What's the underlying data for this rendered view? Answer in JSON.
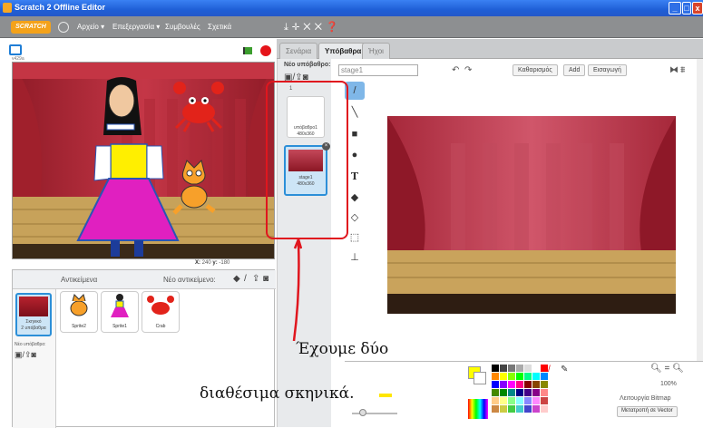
{
  "window": {
    "title": "Scratch 2 Offline Editor",
    "min": "_",
    "max": "□",
    "close": "x"
  },
  "menu": {
    "logo": "SCRATCH",
    "items": [
      "Αρχείο ▾",
      "Επεξεργασία ▾",
      "Συμβουλές",
      "Σχετικά"
    ],
    "tools_glyphs": "⤓✛✕✕❓"
  },
  "stage": {
    "version": "v429a",
    "coord_x_label": "X:",
    "coord_x": "240",
    "coord_y_label": "y:",
    "coord_y": "-180"
  },
  "sprites_pane": {
    "title": "Αντικείμενα",
    "new_sprite": "Νέο αντικείμενο:",
    "stage_thumb": {
      "label": "Σκηνικό",
      "sublabel": "2 υπόβαθρα"
    },
    "new_backdrop": "Νέο υπόβαθρο:",
    "sprites": [
      {
        "name": "Sprite2"
      },
      {
        "name": "Sprite1"
      },
      {
        "name": "Crab"
      }
    ]
  },
  "tabs": [
    {
      "label": "Σενάρια",
      "active": false
    },
    {
      "label": "Υπόβαθρα",
      "active": true
    },
    {
      "label": "Ήχοι",
      "active": false
    }
  ],
  "backdrop_list": {
    "title": "Νέο υπόβαθρο:",
    "items": [
      {
        "num": "1",
        "name": "υπόβαθρο1",
        "size": "480x360",
        "selected": false
      },
      {
        "num": "2",
        "name": "stage1",
        "size": "480x360",
        "selected": true
      }
    ]
  },
  "editor": {
    "name_value": "stage1",
    "buttons": [
      "Καθαρισμός",
      "Add",
      "Εισαγωγή"
    ],
    "zoom": "100%",
    "mode_label": "Λειτουργία Bitmap",
    "convert_button": "Μετατροπή σε Vector",
    "fg_color": "#ffff00",
    "bg_color": "#ffffff"
  },
  "annotation": {
    "line1": "Έχουμε δύο",
    "line2": "διαθέσιμα σκηνικά.",
    "color": "#e0161e"
  }
}
